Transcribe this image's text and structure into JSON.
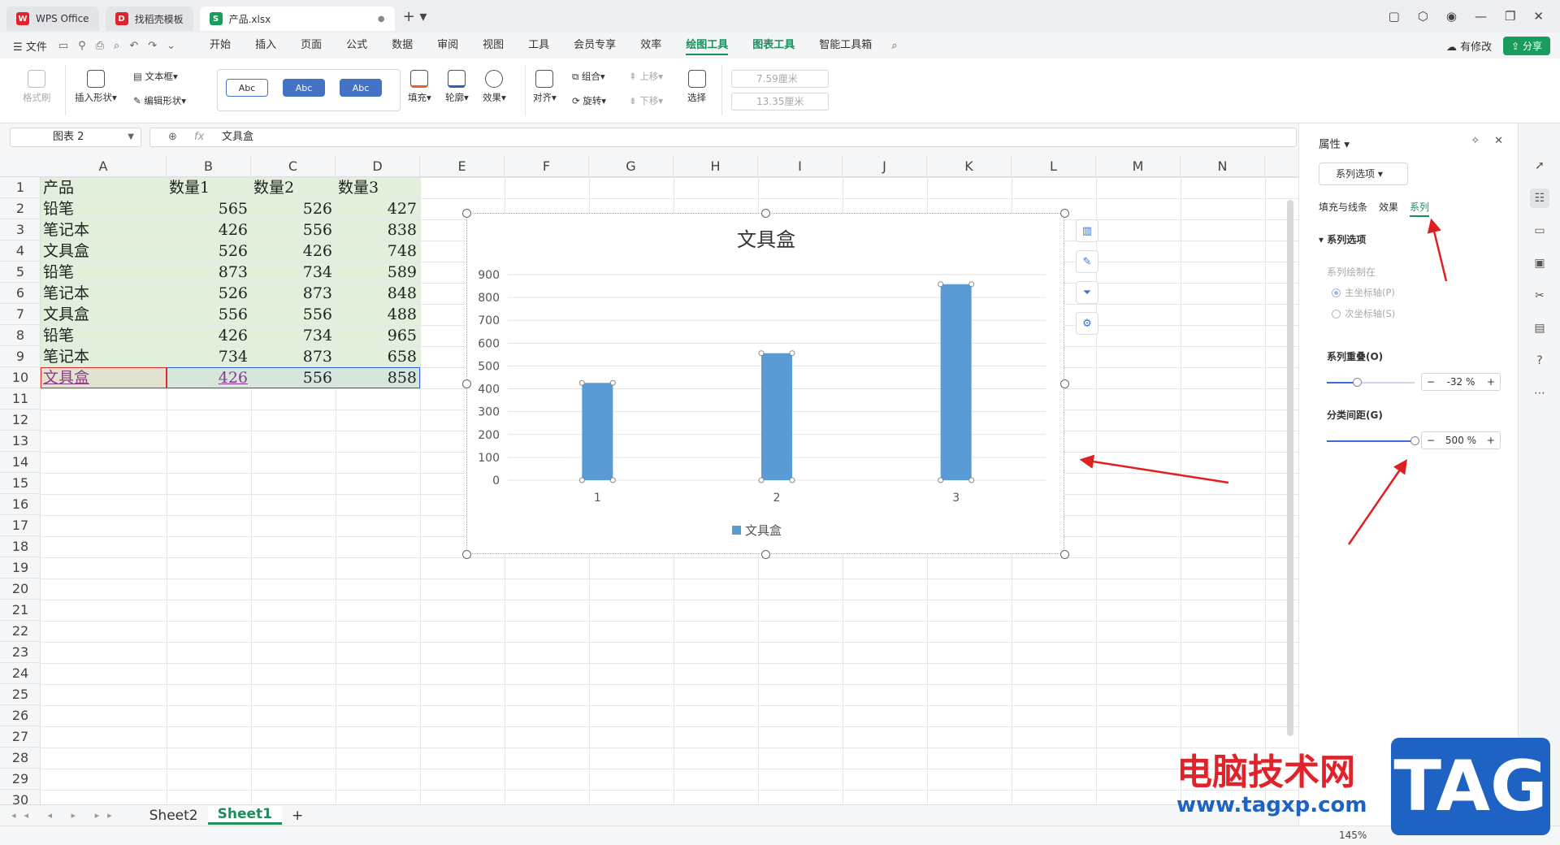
{
  "window": {
    "tabs": [
      {
        "label": "WPS Office",
        "icon": "wps-logo-icon",
        "color": "#e0222a"
      },
      {
        "label": "找稻壳模板",
        "icon": "daoke-logo-icon",
        "color": "#e0222a"
      },
      {
        "label": "产品.xlsx",
        "icon": "sheet-file-icon",
        "color": "#1a9c5c"
      }
    ]
  },
  "menu": {
    "file_label": "文件",
    "tabs": [
      "开始",
      "插入",
      "页面",
      "公式",
      "数据",
      "审阅",
      "视图",
      "工具",
      "会员专享",
      "效率",
      "绘图工具",
      "图表工具",
      "智能工具箱"
    ],
    "active_tab": "绘图工具",
    "modify_label": "有修改",
    "share_label": "分享"
  },
  "ribbon": {
    "format_painter": "格式刷",
    "insert_shape": "插入形状",
    "text_box": "文本框",
    "edit_shape": "编辑形状",
    "style_samples": [
      "Abc",
      "Abc",
      "Abc"
    ],
    "fill": "填充",
    "outline": "轮廓",
    "effect": "效果",
    "align": "对齐",
    "group": "组合",
    "rotate": "旋转",
    "move_up": "上移",
    "move_down": "下移",
    "select": "选择",
    "height_value": "7.59厘米",
    "width_value": "13.35厘米"
  },
  "formula_bar": {
    "name_box": "图表 2",
    "fx_label": "fx",
    "content": "文具盒"
  },
  "sheet": {
    "columns": [
      "A",
      "B",
      "C",
      "D",
      "E",
      "F",
      "G",
      "H",
      "I",
      "J",
      "K",
      "L",
      "M",
      "N"
    ],
    "row_numbers": [
      "1",
      "2",
      "3",
      "4",
      "5",
      "6",
      "7",
      "8",
      "9",
      "10",
      "11",
      "12",
      "13",
      "14",
      "15",
      "16",
      "17",
      "18",
      "19",
      "20",
      "21",
      "22",
      "23",
      "24",
      "25",
      "26",
      "27",
      "28",
      "29",
      "30"
    ],
    "header_row": [
      "产品",
      "数量1",
      "数量2",
      "数量3"
    ],
    "rows": [
      [
        "铅笔",
        "565",
        "526",
        "427"
      ],
      [
        "笔记本",
        "426",
        "556",
        "838"
      ],
      [
        "文具盒",
        "526",
        "426",
        "748"
      ],
      [
        "铅笔",
        "873",
        "734",
        "589"
      ],
      [
        "笔记本",
        "526",
        "873",
        "848"
      ],
      [
        "文具盒",
        "556",
        "556",
        "488"
      ],
      [
        "铅笔",
        "426",
        "734",
        "965"
      ],
      [
        "笔记本",
        "734",
        "873",
        "658"
      ],
      [
        "文具盒",
        "426",
        "556",
        "858"
      ]
    ]
  },
  "chart_data": {
    "type": "bar",
    "title": "文具盒",
    "categories": [
      "1",
      "2",
      "3"
    ],
    "series": [
      {
        "name": "文具盒",
        "values": [
          426,
          556,
          858
        ],
        "color": "#5b9bd5"
      }
    ],
    "ylim": [
      0,
      900
    ],
    "yticks": [
      "0",
      "100",
      "200",
      "300",
      "400",
      "500",
      "600",
      "700",
      "800",
      "900"
    ],
    "grid": true,
    "legend": "bottom"
  },
  "sheet_tabs": {
    "tabs": [
      "Sheet2",
      "Sheet1"
    ],
    "active": "Sheet1",
    "add": "+"
  },
  "status": {
    "zoom": "145%"
  },
  "panel": {
    "title": "属性",
    "dropdown": "系列选项",
    "tabs": [
      "填充与线条",
      "效果",
      "系列"
    ],
    "active_tab": "系列",
    "section": "系列选项",
    "plot_on_label": "系列绘制在",
    "primary_axis": "主坐标轴(P)",
    "secondary_axis": "次坐标轴(S)",
    "overlap_label": "系列重叠(O)",
    "overlap_value": "-32",
    "gap_label": "分类间距(G)",
    "gap_value": "500",
    "percent": "%",
    "minus": "−",
    "plus": "+",
    "overlap_level": 0.34,
    "gap_level": 1.0
  },
  "watermark": {
    "text": "电脑技术网",
    "url": "www.tagxp.com",
    "tag": "TAG",
    "color": "#e0222a"
  }
}
